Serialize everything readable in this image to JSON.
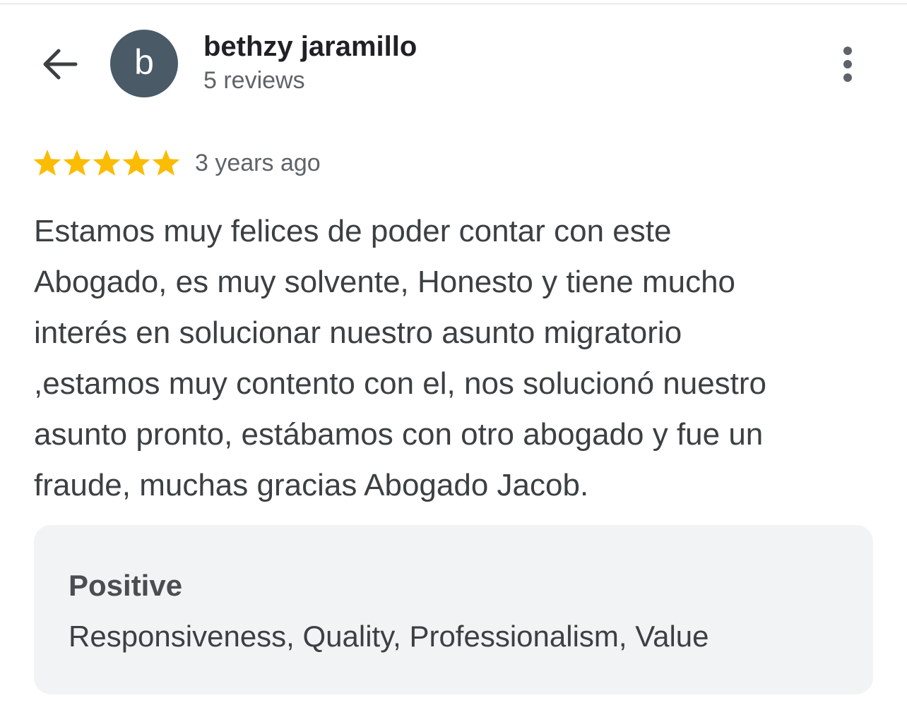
{
  "header": {
    "reviewer_name": "bethzy jaramillo",
    "review_count": "5 reviews",
    "avatar_initial": "b",
    "avatar_color": "#4a5a67",
    "back_icon": "arrow-back-icon",
    "more_icon": "more-vert-icon"
  },
  "review": {
    "rating": 5,
    "rating_max": 5,
    "star_color": "#fbbc04",
    "timestamp": "3 years ago",
    "text_lines": [
      "Estamos muy felices de poder contar con este",
      "Abogado, es muy solvente, Honesto y tiene mucho",
      "interés en solucionar nuestro asunto migratorio",
      ",estamos muy contento con el, nos solucionó nuestro",
      "asunto pronto, estábamos con otro abogado y fue un",
      "fraude, muchas gracias Abogado Jacob."
    ]
  },
  "attributes": {
    "title": "Positive",
    "values": "Responsiveness, Quality, Professionalism, Value",
    "card_color": "#f1f3f4"
  }
}
